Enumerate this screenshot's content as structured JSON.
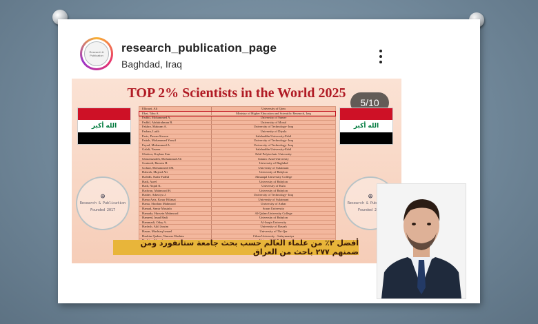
{
  "instagram": {
    "username": "research_publication_page",
    "location": "Baghdad, Iraq",
    "avatar_text": "Research & Publication"
  },
  "post": {
    "title": "TOP 2% Scientists in the World 2025",
    "page_counter": "5/10",
    "flag_text": "الله أكبر",
    "seal_left": {
      "line1": "Research & Publication",
      "line2": "Founded 2017"
    },
    "seal_right": {
      "line1": "Research & Publication",
      "line2": "Founded 2017"
    },
    "caption": "أفضل ٢٪ من علماء العالم حسب بحث جامعة ستانفورد ومن ضمنهم ٢٧٧ باحث من العراق",
    "highlighted_row": 1,
    "rows": [
      {
        "name": "Elkouzi, Ali",
        "university": "University of Qom"
      },
      {
        "name": "Ebzi, Taha A.",
        "university": "Ministry of Higher Education and Scientific Research, Iraq"
      },
      {
        "name": "Fadhil, Mohammed A.",
        "university": "University of Sumer"
      },
      {
        "name": "Fadhil, Abdulrahman B.",
        "university": "University of Mosul"
      },
      {
        "name": "Fakhry, Makram A.",
        "university": "University of Technology- Iraq"
      },
      {
        "name": "Farhan, Laith",
        "university": "University of Diyala"
      },
      {
        "name": "Faris, Pawan Sirwan",
        "university": "Salahaddin University-Erbil"
      },
      {
        "name": "Fattah, Mohammed Yousif",
        "university": "University of Technology- Iraq"
      },
      {
        "name": "Fayad, Mohammed A.",
        "university": "University of Technology- Iraq"
      },
      {
        "name": "Galali, Yaseen",
        "university": "Salahaddin University-Erbil"
      },
      {
        "name": "Ghafoor, Kayhan Zrar",
        "university": "Erbil Polytechnic University"
      },
      {
        "name": "Ghasemzadeh, Mohammad Ali",
        "university": "Islamic Azad University"
      },
      {
        "name": "Grainedi, Bassim H.",
        "university": "University of Baghdad"
      },
      {
        "name": "Gohari, Mohammed I.M.",
        "university": "University of Sulaimani"
      },
      {
        "name": "Habeeb, Majeed Ali",
        "university": "University of Babylon"
      },
      {
        "name": "Hafedh, Nadir Fadhil",
        "university": "Almaaqal University College"
      },
      {
        "name": "Hadi, Aseel",
        "university": "University of Babylon"
      },
      {
        "name": "Hadi, Najah K.",
        "university": "University of Kufa"
      },
      {
        "name": "Hadwan, Mahmood H.",
        "university": "University of Babylon"
      },
      {
        "name": "Haider, Adawiya J.",
        "university": "University of Technology- Iraq"
      },
      {
        "name": "Hama Aziz, Kosar Hikmat",
        "university": "University of Sulaimani"
      },
      {
        "name": "Hama, Shorhan Mahmood",
        "university": "University of Anbar"
      },
      {
        "name": "Hamad, Samir Mustafa",
        "university": "Soran University"
      },
      {
        "name": "Hamada, Hussein Mahmood",
        "university": "Al-Qalam University College"
      },
      {
        "name": "Hameed, Imad Hadi",
        "university": "University of Babylon"
      },
      {
        "name": "Hammadi, Oday A.",
        "university": "Al-Iraqia University"
      },
      {
        "name": "Harfash, Akil Jassim",
        "university": "University of Basrah"
      },
      {
        "name": "Hasan, Mushtaq Ismael",
        "university": "University of Thi-Qar"
      },
      {
        "name": "Hashim Qadeer, Nameer Hashim",
        "university": "Cihan University - Sulaymaniya"
      },
      {
        "name": "Hashim, Ahmed",
        "university": "University of Babylon"
      }
    ]
  },
  "colors": {
    "title": "#b01a24",
    "caption_bg": "#e8b53a",
    "post_bg": "#f6cdb8"
  }
}
